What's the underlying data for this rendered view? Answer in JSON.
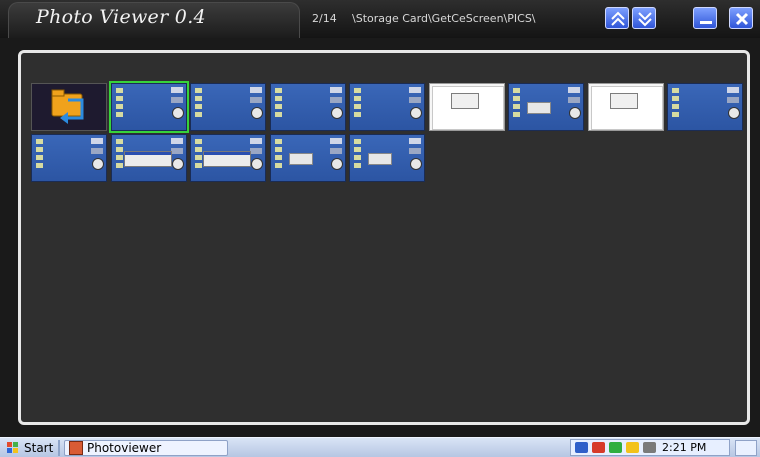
{
  "app": {
    "title": "Photo Viewer 0.4",
    "counter": "2/14",
    "path": "\\Storage Card\\GetCeScreen\\PICS\\"
  },
  "toolbar": {
    "up_icon": "double-up-arrow-icon",
    "down_icon": "double-down-arrow-icon",
    "minimize_icon": "minimize-icon",
    "close_icon": "close-icon"
  },
  "thumbnails": {
    "row1": [
      {
        "kind": "folder-up"
      },
      {
        "kind": "blue",
        "selected": true
      },
      {
        "kind": "blue"
      },
      {
        "kind": "blue"
      },
      {
        "kind": "blue"
      },
      {
        "kind": "white"
      },
      {
        "kind": "blue-dialog"
      },
      {
        "kind": "white-dialog"
      },
      {
        "kind": "blue"
      }
    ],
    "row2": [
      {
        "kind": "blue"
      },
      {
        "kind": "blue-wide-dialog"
      },
      {
        "kind": "blue-wide-dialog"
      },
      {
        "kind": "blue-dialog"
      },
      {
        "kind": "blue-dialog"
      }
    ]
  },
  "taskbar": {
    "start_label": "Start",
    "task_label": "Photoviewer",
    "time": "2:21 PM"
  },
  "colors": {
    "selection": "#37d33a",
    "thumb_blue": "#3a67b8",
    "panel_bg": "#2f2f2f"
  }
}
